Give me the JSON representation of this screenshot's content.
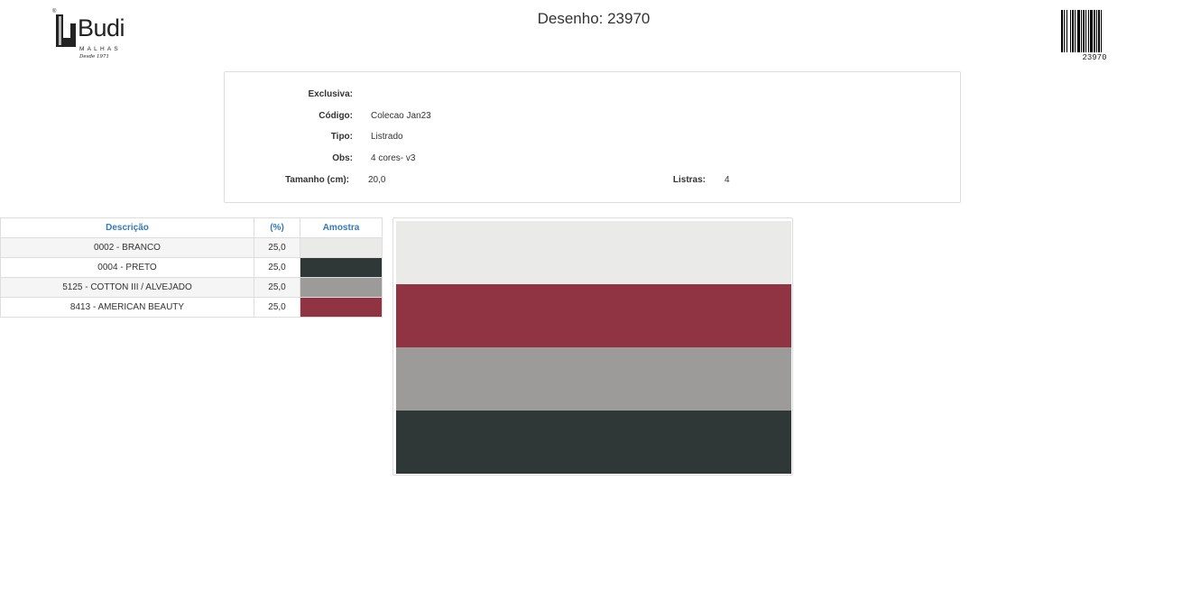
{
  "brand": {
    "name": "Budi",
    "subtitle": "MALHAS",
    "since": "Desde 1971",
    "registered_mark": "®"
  },
  "page_title": "Desenho: 23970",
  "barcode": {
    "number": "23970"
  },
  "info": {
    "exclusiva_label": "Exclusiva:",
    "exclusiva_value": "",
    "codigo_label": "Código:",
    "codigo_value": "Colecao Jan23",
    "tipo_label": "Tipo:",
    "tipo_value": "Listrado",
    "obs_label": "Obs:",
    "obs_value": "4 cores- v3",
    "tamanho_label": "Tamanho (cm):",
    "tamanho_value": "20,0",
    "listras_label": "Listras:",
    "listras_value": "4"
  },
  "colors_table": {
    "headers": [
      "Descrição",
      "(%)",
      "Amostra"
    ],
    "rows": [
      {
        "descricao": "0002 - BRANCO",
        "percent": "25,0",
        "color": "#eaebe8"
      },
      {
        "descricao": "0004 - PRETO",
        "percent": "25,0",
        "color": "#303837"
      },
      {
        "descricao": "5125 - COTTON III / ALVEJADO",
        "percent": "25,0",
        "color": "#9c9b99"
      },
      {
        "descricao": "8413 - AMERICAN BEAUTY",
        "percent": "25,0",
        "color": "#903444"
      }
    ]
  },
  "stripes": [
    {
      "color": "#eaebe8"
    },
    {
      "color": "#903444"
    },
    {
      "color": "#9c9b99"
    },
    {
      "color": "#303837"
    }
  ]
}
